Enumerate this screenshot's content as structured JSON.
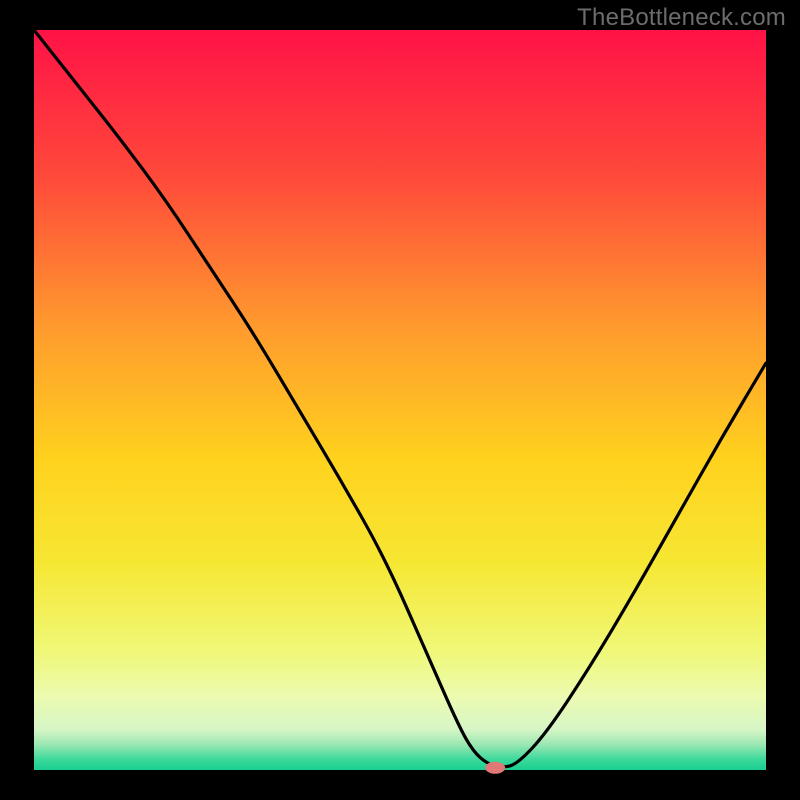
{
  "watermark": "TheBottleneck.com",
  "colors": {
    "frame": "#000000",
    "curve_stroke": "#000000",
    "marker_fill": "#e07878",
    "watermark_text": "#6c6c6c"
  },
  "chart_data": {
    "type": "line",
    "title": "",
    "xlabel": "",
    "ylabel": "",
    "x_range": [
      0,
      100
    ],
    "y_range_percent": [
      0,
      100
    ],
    "gradient_stops": [
      {
        "offset": 0.0,
        "color": "#ff1247"
      },
      {
        "offset": 0.2,
        "color": "#ff4a3a"
      },
      {
        "offset": 0.4,
        "color": "#ff9a2e"
      },
      {
        "offset": 0.58,
        "color": "#ffd21e"
      },
      {
        "offset": 0.72,
        "color": "#f6e733"
      },
      {
        "offset": 0.84,
        "color": "#f0f878"
      },
      {
        "offset": 0.9,
        "color": "#ecfbb0"
      },
      {
        "offset": 0.945,
        "color": "#d7f6c6"
      },
      {
        "offset": 0.965,
        "color": "#9de8b3"
      },
      {
        "offset": 0.985,
        "color": "#3fd99c"
      },
      {
        "offset": 1.0,
        "color": "#18cf8f"
      }
    ],
    "series": [
      {
        "name": "bottleneck-curve",
        "x": [
          0,
          6,
          12,
          18,
          24,
          30,
          36,
          42,
          48,
          54,
          58,
          60,
          62,
          64,
          66,
          70,
          76,
          82,
          88,
          94,
          100
        ],
        "y": [
          100,
          92.5,
          85,
          77,
          68,
          59,
          49,
          39,
          28.5,
          15,
          6,
          2.5,
          0.8,
          0.3,
          0.8,
          5,
          14,
          24,
          34.5,
          45,
          55
        ]
      }
    ],
    "marker": {
      "x": 63,
      "y": 0.3,
      "rx": 10,
      "ry": 6
    },
    "notes": "y is percent of plot height from bottom; curve is a V reaching ~0 near x≈63 with a small pink marker covering x≈61–65."
  }
}
